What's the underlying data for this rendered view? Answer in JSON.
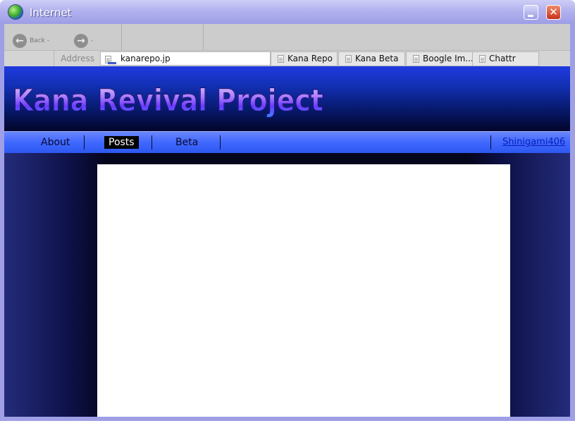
{
  "window": {
    "title": "Internet",
    "icon": "globe-icon"
  },
  "toolbar": {
    "back_label": "Back -",
    "forward_label": "-"
  },
  "address": {
    "label": "Address",
    "url": "kanarepo.jp"
  },
  "tabs": [
    {
      "label": "Kana Repo"
    },
    {
      "label": "Kana Beta"
    },
    {
      "label": "Boogle Im..."
    },
    {
      "label": "Chattr"
    }
  ],
  "site": {
    "title": "Kana Revival Project",
    "nav": [
      {
        "label": "About",
        "active": false
      },
      {
        "label": "Posts",
        "active": true
      },
      {
        "label": "Beta",
        "active": false
      }
    ],
    "user": "Shinigami406"
  },
  "colors": {
    "frame": "#9f9fe6",
    "header_top": "#1f3adf",
    "navbar": "#3f68ff",
    "page_bg": "#06061a",
    "link": "#0a20b8"
  }
}
